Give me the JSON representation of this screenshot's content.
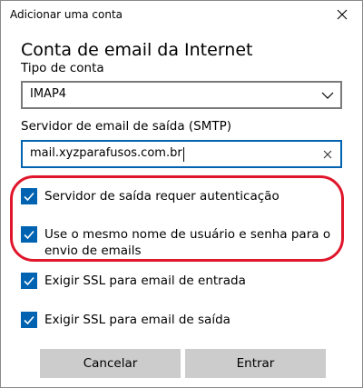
{
  "window": {
    "title": "Adicionar uma conta",
    "close_icon": "close-icon"
  },
  "form": {
    "heading": "Conta de email da Internet",
    "account_type": {
      "label": "Tipo de conta",
      "value": "IMAP4"
    },
    "smtp_server": {
      "label": "Servidor de email de saída (SMTP)",
      "value": "mail.xyzparafusos.com.br"
    },
    "options": [
      {
        "label": "Servidor de saída requer autenticação",
        "checked": true
      },
      {
        "label": "Use o mesmo nome de usuário e senha para o envio de emails",
        "checked": true
      },
      {
        "label": "Exigir SSL para email de entrada",
        "checked": true
      },
      {
        "label": "Exigir SSL para email de saída",
        "checked": true
      }
    ]
  },
  "buttons": {
    "cancel": "Cancelar",
    "enter": "Entrar"
  },
  "colors": {
    "accent": "#0063b1",
    "highlight_ring": "#e0162b",
    "button_bg": "#cccccc"
  }
}
